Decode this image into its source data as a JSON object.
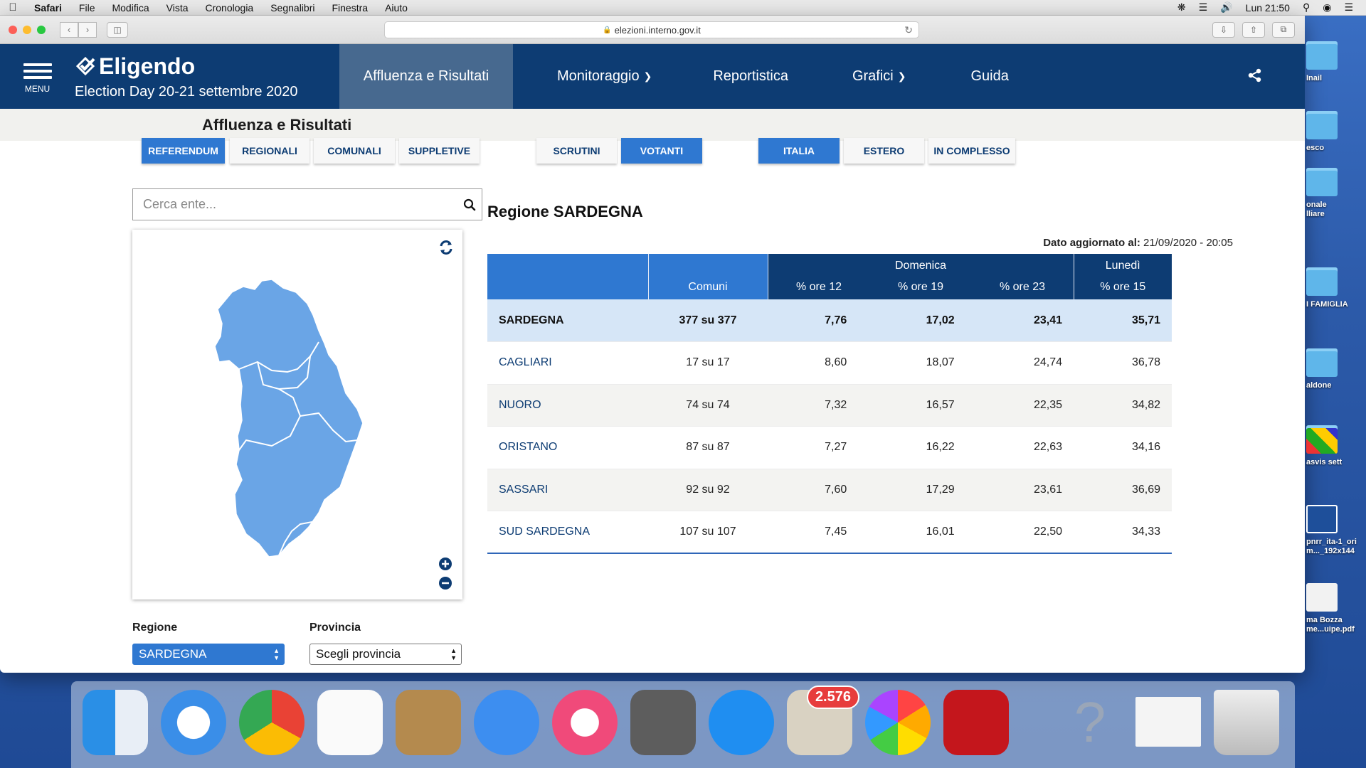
{
  "menubar": {
    "app": "Safari",
    "items": [
      "File",
      "Modifica",
      "Vista",
      "Cronologia",
      "Segnalibri",
      "Finestra",
      "Aiuto"
    ],
    "clock": "Lun 21:50"
  },
  "browser": {
    "url": "elezioni.interno.gov.it"
  },
  "site": {
    "menu_label": "MENU",
    "brand": "Eligendo",
    "subtitle": "Election Day 20-21 settembre 2020",
    "nav": [
      {
        "label": "Affluenza e Risultati",
        "active": true
      },
      {
        "label": "Monitoraggio",
        "dropdown": true
      },
      {
        "label": "Reportistica"
      },
      {
        "label": "Grafici",
        "dropdown": true
      },
      {
        "label": "Guida"
      }
    ],
    "page_title": "Affluenza e Risultati"
  },
  "filters": {
    "type": [
      "REFERENDUM",
      "REGIONALI",
      "COMUNALI",
      "SUPPLETIVE"
    ],
    "mode": [
      "SCRUTINI",
      "VOTANTI"
    ],
    "scope": [
      "ITALIA",
      "ESTERO",
      "IN COMPLESSO"
    ]
  },
  "search": {
    "placeholder": "Cerca ente..."
  },
  "selectors": {
    "region_label": "Regione",
    "region_value": "SARDEGNA",
    "province_label": "Provincia",
    "province_value": "Scegli provincia"
  },
  "results": {
    "title": "Regione SARDEGNA",
    "updated_label": "Dato aggiornato al:",
    "updated_value": "21/09/2020 - 20:05",
    "group_sunday": "Domenica",
    "group_monday": "Lunedì",
    "headers": [
      "Comuni",
      "% ore 12",
      "% ore 19",
      "% ore 23",
      "% ore 15"
    ],
    "rows": [
      {
        "name": "SARDEGNA",
        "comuni": "377 su 377",
        "h12": "7,76",
        "h19": "17,02",
        "h23": "23,41",
        "h15": "35,71"
      },
      {
        "name": "CAGLIARI",
        "comuni": "17 su 17",
        "h12": "8,60",
        "h19": "18,07",
        "h23": "24,74",
        "h15": "36,78"
      },
      {
        "name": "NUORO",
        "comuni": "74 su 74",
        "h12": "7,32",
        "h19": "16,57",
        "h23": "22,35",
        "h15": "34,82"
      },
      {
        "name": "ORISTANO",
        "comuni": "87 su 87",
        "h12": "7,27",
        "h19": "16,22",
        "h23": "22,63",
        "h15": "34,16"
      },
      {
        "name": "SASSARI",
        "comuni": "92 su 92",
        "h12": "7,60",
        "h19": "17,29",
        "h23": "23,61",
        "h15": "36,69"
      },
      {
        "name": "SUD SARDEGNA",
        "comuni": "107 su 107",
        "h12": "7,45",
        "h19": "16,01",
        "h23": "22,50",
        "h15": "34,33"
      }
    ]
  },
  "desktop": {
    "icons": [
      "Inail",
      "esco",
      "onale\nlliare",
      "I FAMIGLIA",
      "aldone",
      "asvis sett",
      "pnrr_ita-1_ori\nm..._192x144",
      "ma Bozza\nme...uipe.pdf"
    ]
  },
  "dock": {
    "mail_badge": "2.576"
  },
  "colors": {
    "header_navy": "#0d3c73",
    "accent_blue": "#2f78d1",
    "active_nav": "#47698f",
    "map_fill": "#6aa5e6"
  }
}
